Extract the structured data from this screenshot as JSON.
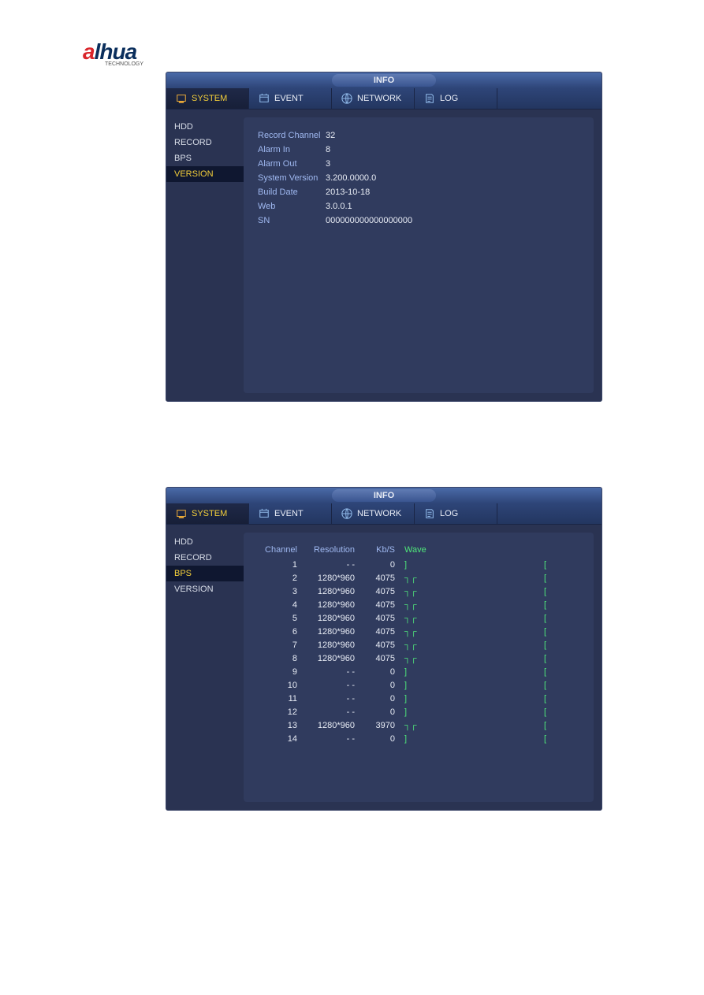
{
  "logo": {
    "prefix": "a",
    "rest": "lhua",
    "sub": "TECHNOLOGY"
  },
  "titlebar": {
    "info": "INFO"
  },
  "tabs": [
    {
      "label": "SYSTEM",
      "icon": "system"
    },
    {
      "label": "EVENT",
      "icon": "event"
    },
    {
      "label": "NETWORK",
      "icon": "network"
    },
    {
      "label": "LOG",
      "icon": "log"
    }
  ],
  "sidebar_items": [
    "HDD",
    "RECORD",
    "BPS",
    "VERSION"
  ],
  "panel1": {
    "active_side": "VERSION",
    "rows": [
      {
        "label": "Record Channel",
        "value": "32"
      },
      {
        "label": "Alarm In",
        "value": "8"
      },
      {
        "label": "Alarm Out",
        "value": "3"
      },
      {
        "label": "System Version",
        "value": "3.200.0000.0"
      },
      {
        "label": "Build Date",
        "value": "2013-10-18"
      },
      {
        "label": "Web",
        "value": "3.0.0.1"
      },
      {
        "label": "SN",
        "value": "000000000000000000"
      }
    ]
  },
  "panel2": {
    "active_side": "BPS",
    "headers": {
      "channel": "Channel",
      "res": "Resolution",
      "kb": "Kb/S",
      "wave": "Wave"
    },
    "rows": [
      {
        "ch": "1",
        "res": "- -",
        "kb": "0",
        "wave": "idle"
      },
      {
        "ch": "2",
        "res": "1280*960",
        "kb": "4075",
        "wave": "active"
      },
      {
        "ch": "3",
        "res": "1280*960",
        "kb": "4075",
        "wave": "active"
      },
      {
        "ch": "4",
        "res": "1280*960",
        "kb": "4075",
        "wave": "active"
      },
      {
        "ch": "5",
        "res": "1280*960",
        "kb": "4075",
        "wave": "active"
      },
      {
        "ch": "6",
        "res": "1280*960",
        "kb": "4075",
        "wave": "active"
      },
      {
        "ch": "7",
        "res": "1280*960",
        "kb": "4075",
        "wave": "active"
      },
      {
        "ch": "8",
        "res": "1280*960",
        "kb": "4075",
        "wave": "active"
      },
      {
        "ch": "9",
        "res": "- -",
        "kb": "0",
        "wave": "idle"
      },
      {
        "ch": "10",
        "res": "- -",
        "kb": "0",
        "wave": "idle"
      },
      {
        "ch": "11",
        "res": "- -",
        "kb": "0",
        "wave": "idle"
      },
      {
        "ch": "12",
        "res": "- -",
        "kb": "0",
        "wave": "idle"
      },
      {
        "ch": "13",
        "res": "1280*960",
        "kb": "3970",
        "wave": "active"
      },
      {
        "ch": "14",
        "res": "- -",
        "kb": "0",
        "wave": "idle"
      }
    ],
    "end_glyph": "[",
    "wave_idle_glyph": "]",
    "wave_active_glyph": "┐┌"
  }
}
